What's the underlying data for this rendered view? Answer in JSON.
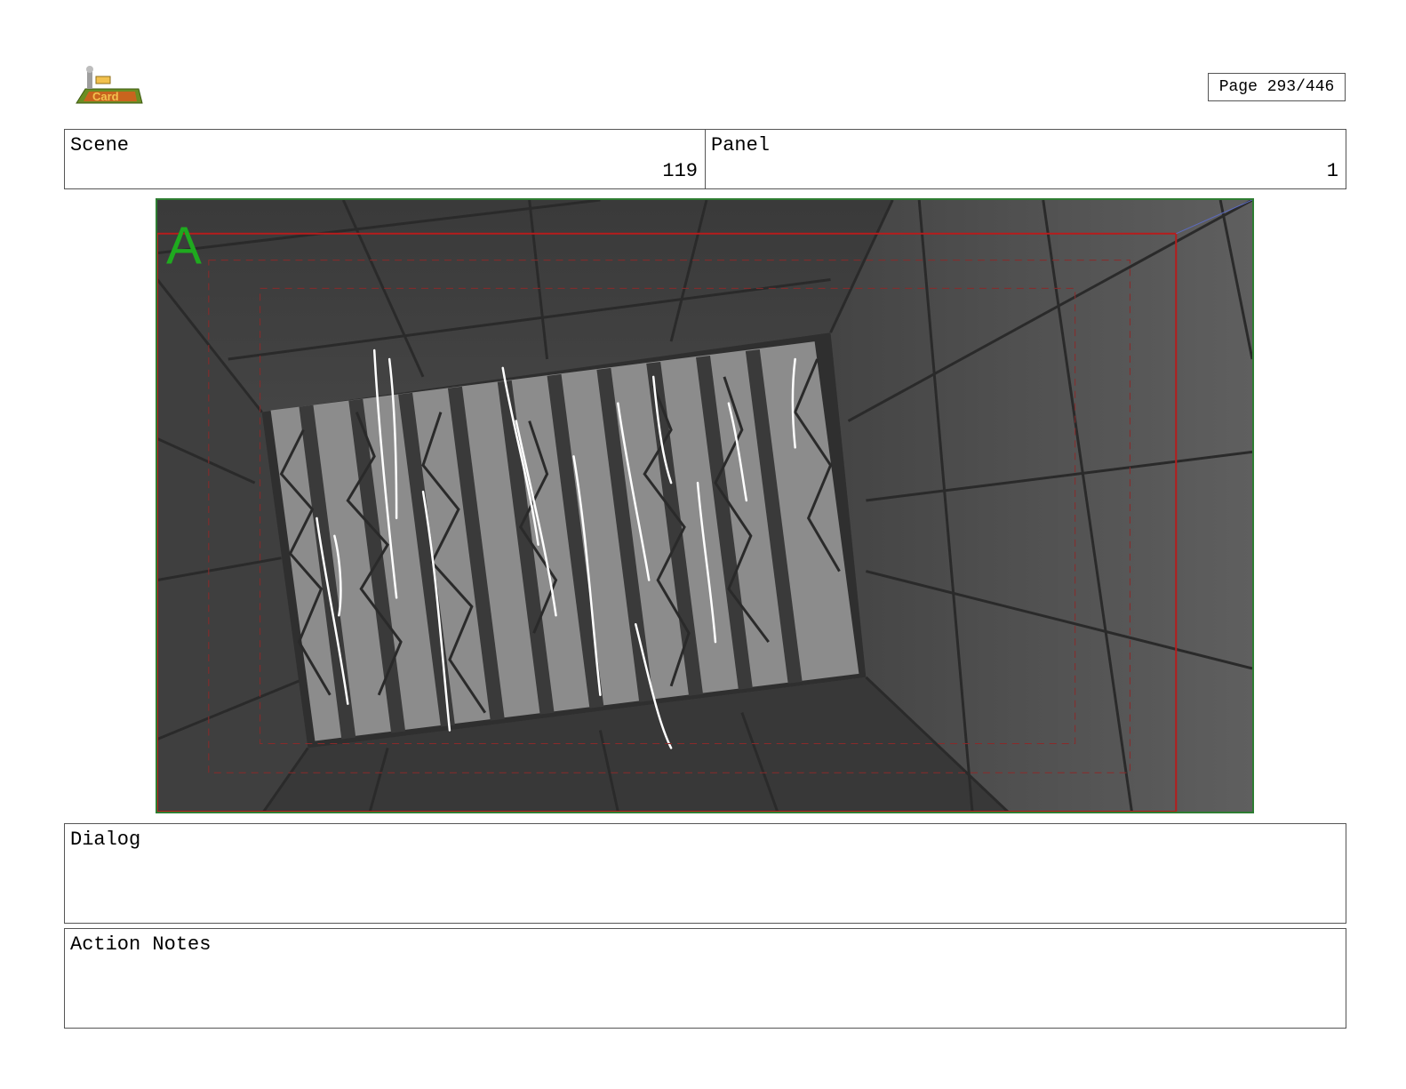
{
  "header": {
    "page_label": "Page 293/446",
    "logo_icon": "pic-game-logo-icon"
  },
  "scene": {
    "label": "Scene",
    "value": "119"
  },
  "panel": {
    "label": "Panel",
    "value": "1"
  },
  "drawing": {
    "layer_marker": "A",
    "marker_color": "#1faa1f",
    "frame_color": "#2e7d32",
    "safe_frame_color": "#b71c1c"
  },
  "dialog": {
    "label": "Dialog",
    "text": ""
  },
  "action_notes": {
    "label": "Action Notes",
    "text": ""
  }
}
